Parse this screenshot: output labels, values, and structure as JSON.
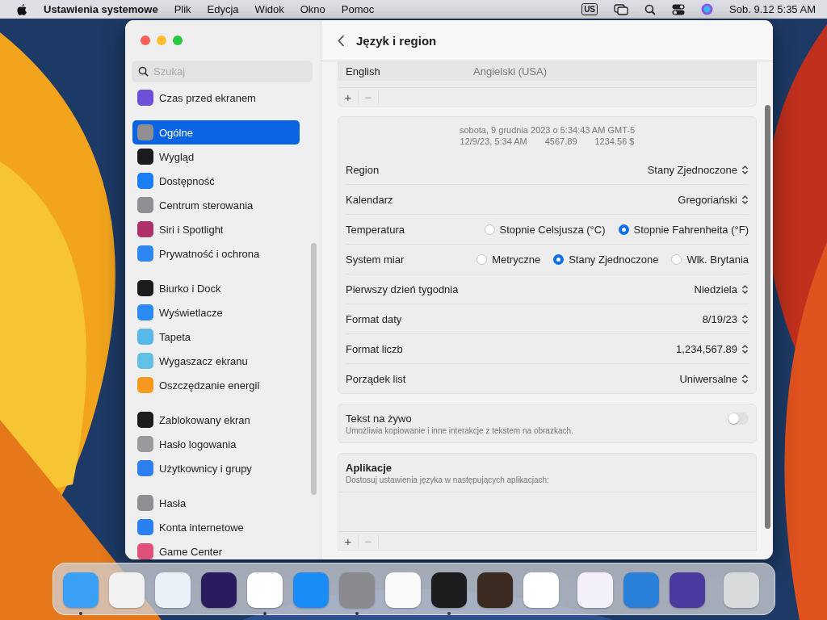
{
  "menu_bar": {
    "app_name": "Ustawienia systemowe",
    "menus": [
      "Plik",
      "Edycja",
      "Widok",
      "Okno",
      "Pomoc"
    ],
    "input_source": "US",
    "clock": "Sob. 9.12  5:35 AM"
  },
  "window": {
    "title": "Język i region"
  },
  "sidebar": {
    "search": {
      "placeholder": "Szukaj"
    },
    "groups": [
      [
        {
          "label": "Czas przed ekranem",
          "color": "#6e4fd8",
          "selected": false
        }
      ],
      [
        {
          "label": "Ogólne",
          "color": "#8e8e93",
          "selected": true
        },
        {
          "label": "Wygląd",
          "color": "#1c1c1e",
          "selected": false
        },
        {
          "label": "Dostępność",
          "color": "#1a7ef5",
          "selected": false
        },
        {
          "label": "Centrum sterowania",
          "color": "#8e8e93",
          "selected": false
        },
        {
          "label": "Siri i Spotlight",
          "color": "#b0306a",
          "selected": false
        },
        {
          "label": "Prywatność i ochrona",
          "color": "#2f86f0",
          "selected": false
        }
      ],
      [
        {
          "label": "Biurko i Dock",
          "color": "#1c1c1e",
          "selected": false
        },
        {
          "label": "Wyświetlacze",
          "color": "#2b8af5",
          "selected": false
        },
        {
          "label": "Tapeta",
          "color": "#5ab8e8",
          "selected": false
        },
        {
          "label": "Wygaszacz ekranu",
          "color": "#62c0e6",
          "selected": false
        },
        {
          "label": "Oszczędzanie energii",
          "color": "#f59a1e",
          "selected": false
        }
      ],
      [
        {
          "label": "Zablokowany ekran",
          "color": "#1c1c1e",
          "selected": false
        },
        {
          "label": "Hasło logowania",
          "color": "#9a9a9e",
          "selected": false
        },
        {
          "label": "Użytkownicy i grupy",
          "color": "#2f7ff0",
          "selected": false
        }
      ],
      [
        {
          "label": "Hasła",
          "color": "#8e8e93",
          "selected": false
        },
        {
          "label": "Konta internetowe",
          "color": "#2a80f0",
          "selected": false
        },
        {
          "label": "Game Center",
          "color": "#e0507a",
          "selected": false
        }
      ]
    ]
  },
  "languages": [
    {
      "name": "English",
      "native": "Angielski (USA)"
    }
  ],
  "language_list_controls": [
    "+",
    "−"
  ],
  "preview": {
    "line_1": "sobota, 9 grudnia 2023 o 5:34:43 AM GMT-5",
    "line_2": [
      "12/9/23, 5:34 AM",
      "4567.89",
      "1234.56 $"
    ]
  },
  "settings": [
    {
      "kind": "select",
      "label": "Region",
      "value": "Stany Zjednoczone"
    },
    {
      "kind": "select",
      "label": "Kalendarz",
      "value": "Gregoriański"
    },
    {
      "kind": "radio",
      "label": "Temperatura",
      "options": [
        {
          "label": "Stopnie Celsjusza (°C)",
          "selected": false
        },
        {
          "label": "Stopnie Fahrenheita (°F)",
          "selected": true
        }
      ]
    },
    {
      "kind": "radio",
      "label": "System miar",
      "options": [
        {
          "label": "Metryczne",
          "selected": false
        },
        {
          "label": "Stany Zjednoczone",
          "selected": true
        },
        {
          "label": "Wlk. Brytania",
          "selected": false
        }
      ]
    },
    {
      "kind": "select",
      "label": "Pierwszy dzień tygodnia",
      "value": "Niedziela"
    },
    {
      "kind": "select",
      "label": "Format daty",
      "value": "8/19/23"
    },
    {
      "kind": "select",
      "label": "Format liczb",
      "value": "1,234,567.89"
    },
    {
      "kind": "select",
      "label": "Porządek list",
      "value": "Uniwersalne"
    }
  ],
  "live_text": {
    "title": "Tekst na żywo",
    "description": "Umożliwia kopiowanie i inne interakcje z tekstem na obrazkach.",
    "on": false
  },
  "apps": {
    "title": "Aplikacje",
    "description": "Dostosuj ustawienia języka w następujących aplikacjach:",
    "controls": [
      "+",
      "−"
    ]
  },
  "dock": [
    {
      "color": "#3aa0f5",
      "running": true
    },
    {
      "color": "#f2f2f2",
      "running": false
    },
    {
      "color": "#e8f0f8",
      "running": false
    },
    {
      "color": "#2a1a5e",
      "running": false
    },
    {
      "color": "#ffffff",
      "running": true
    },
    {
      "color": "#1a8cf5",
      "running": false
    },
    {
      "color": "#8a8a8e",
      "running": true
    },
    {
      "color": "#fafafa",
      "running": false
    },
    {
      "color": "#1c1c1e",
      "running": true
    },
    {
      "color": "#3a2a20",
      "running": false
    },
    {
      "color": "#ffffff",
      "running": false
    },
    {
      "color": "#f4f0fa",
      "running": false
    },
    {
      "color": "#2a7fd8",
      "running": false
    },
    {
      "color": "#4a3aa0",
      "running": false
    },
    {
      "color": "#d8dadc",
      "running": false
    }
  ]
}
